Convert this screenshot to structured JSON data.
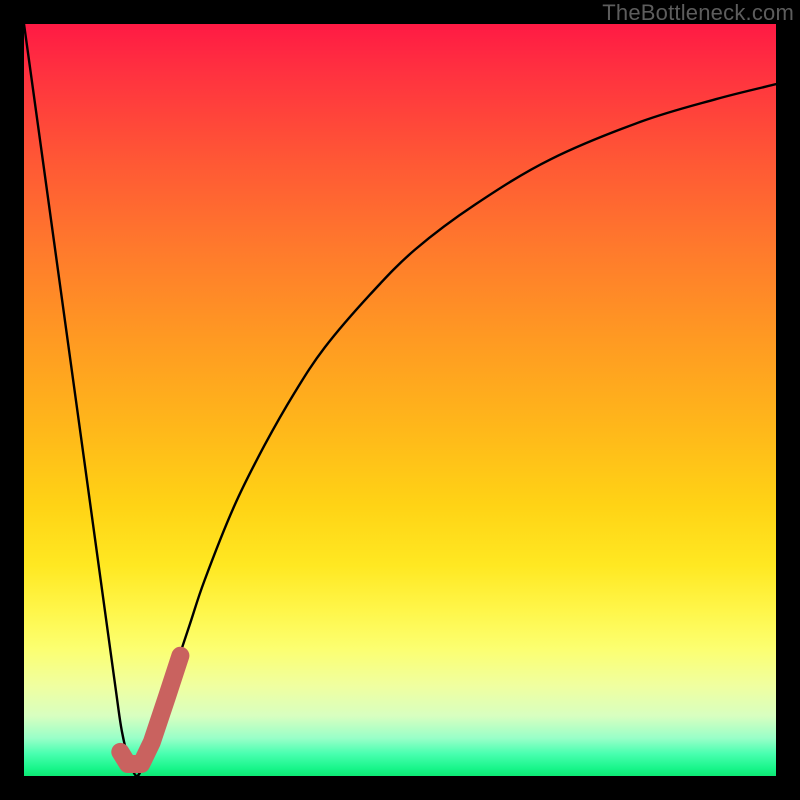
{
  "watermark": "TheBottleneck.com",
  "colors": {
    "frame": "#000000",
    "curve": "#000000",
    "marker_fill": "#c9625f",
    "marker_stroke": "#c9625f",
    "gradient_top": "#ff1a44",
    "gradient_bottom": "#0ee874"
  },
  "chart_data": {
    "type": "line",
    "title": "",
    "xlabel": "",
    "ylabel": "",
    "xlim": [
      0,
      100
    ],
    "ylim": [
      0,
      100
    ],
    "grid": false,
    "series": [
      {
        "name": "bottleneck-curve",
        "x": [
          0,
          4,
          8,
          12,
          13,
          14,
          15,
          16,
          18,
          20,
          22,
          24,
          28,
          32,
          36,
          40,
          46,
          52,
          60,
          70,
          82,
          92,
          100
        ],
        "y": [
          100,
          71,
          42,
          13,
          6,
          2,
          0,
          2,
          8,
          14,
          20,
          26,
          36,
          44,
          51,
          57,
          64,
          70,
          76,
          82,
          87,
          90,
          92
        ]
      }
    ],
    "annotations": [
      {
        "name": "marker-segment",
        "type": "polyline",
        "x": [
          12.8,
          13.8,
          15.6,
          17.0,
          19.0,
          20.8
        ],
        "y": [
          3.2,
          1.6,
          1.6,
          4.5,
          10.5,
          16.0
        ]
      }
    ]
  }
}
